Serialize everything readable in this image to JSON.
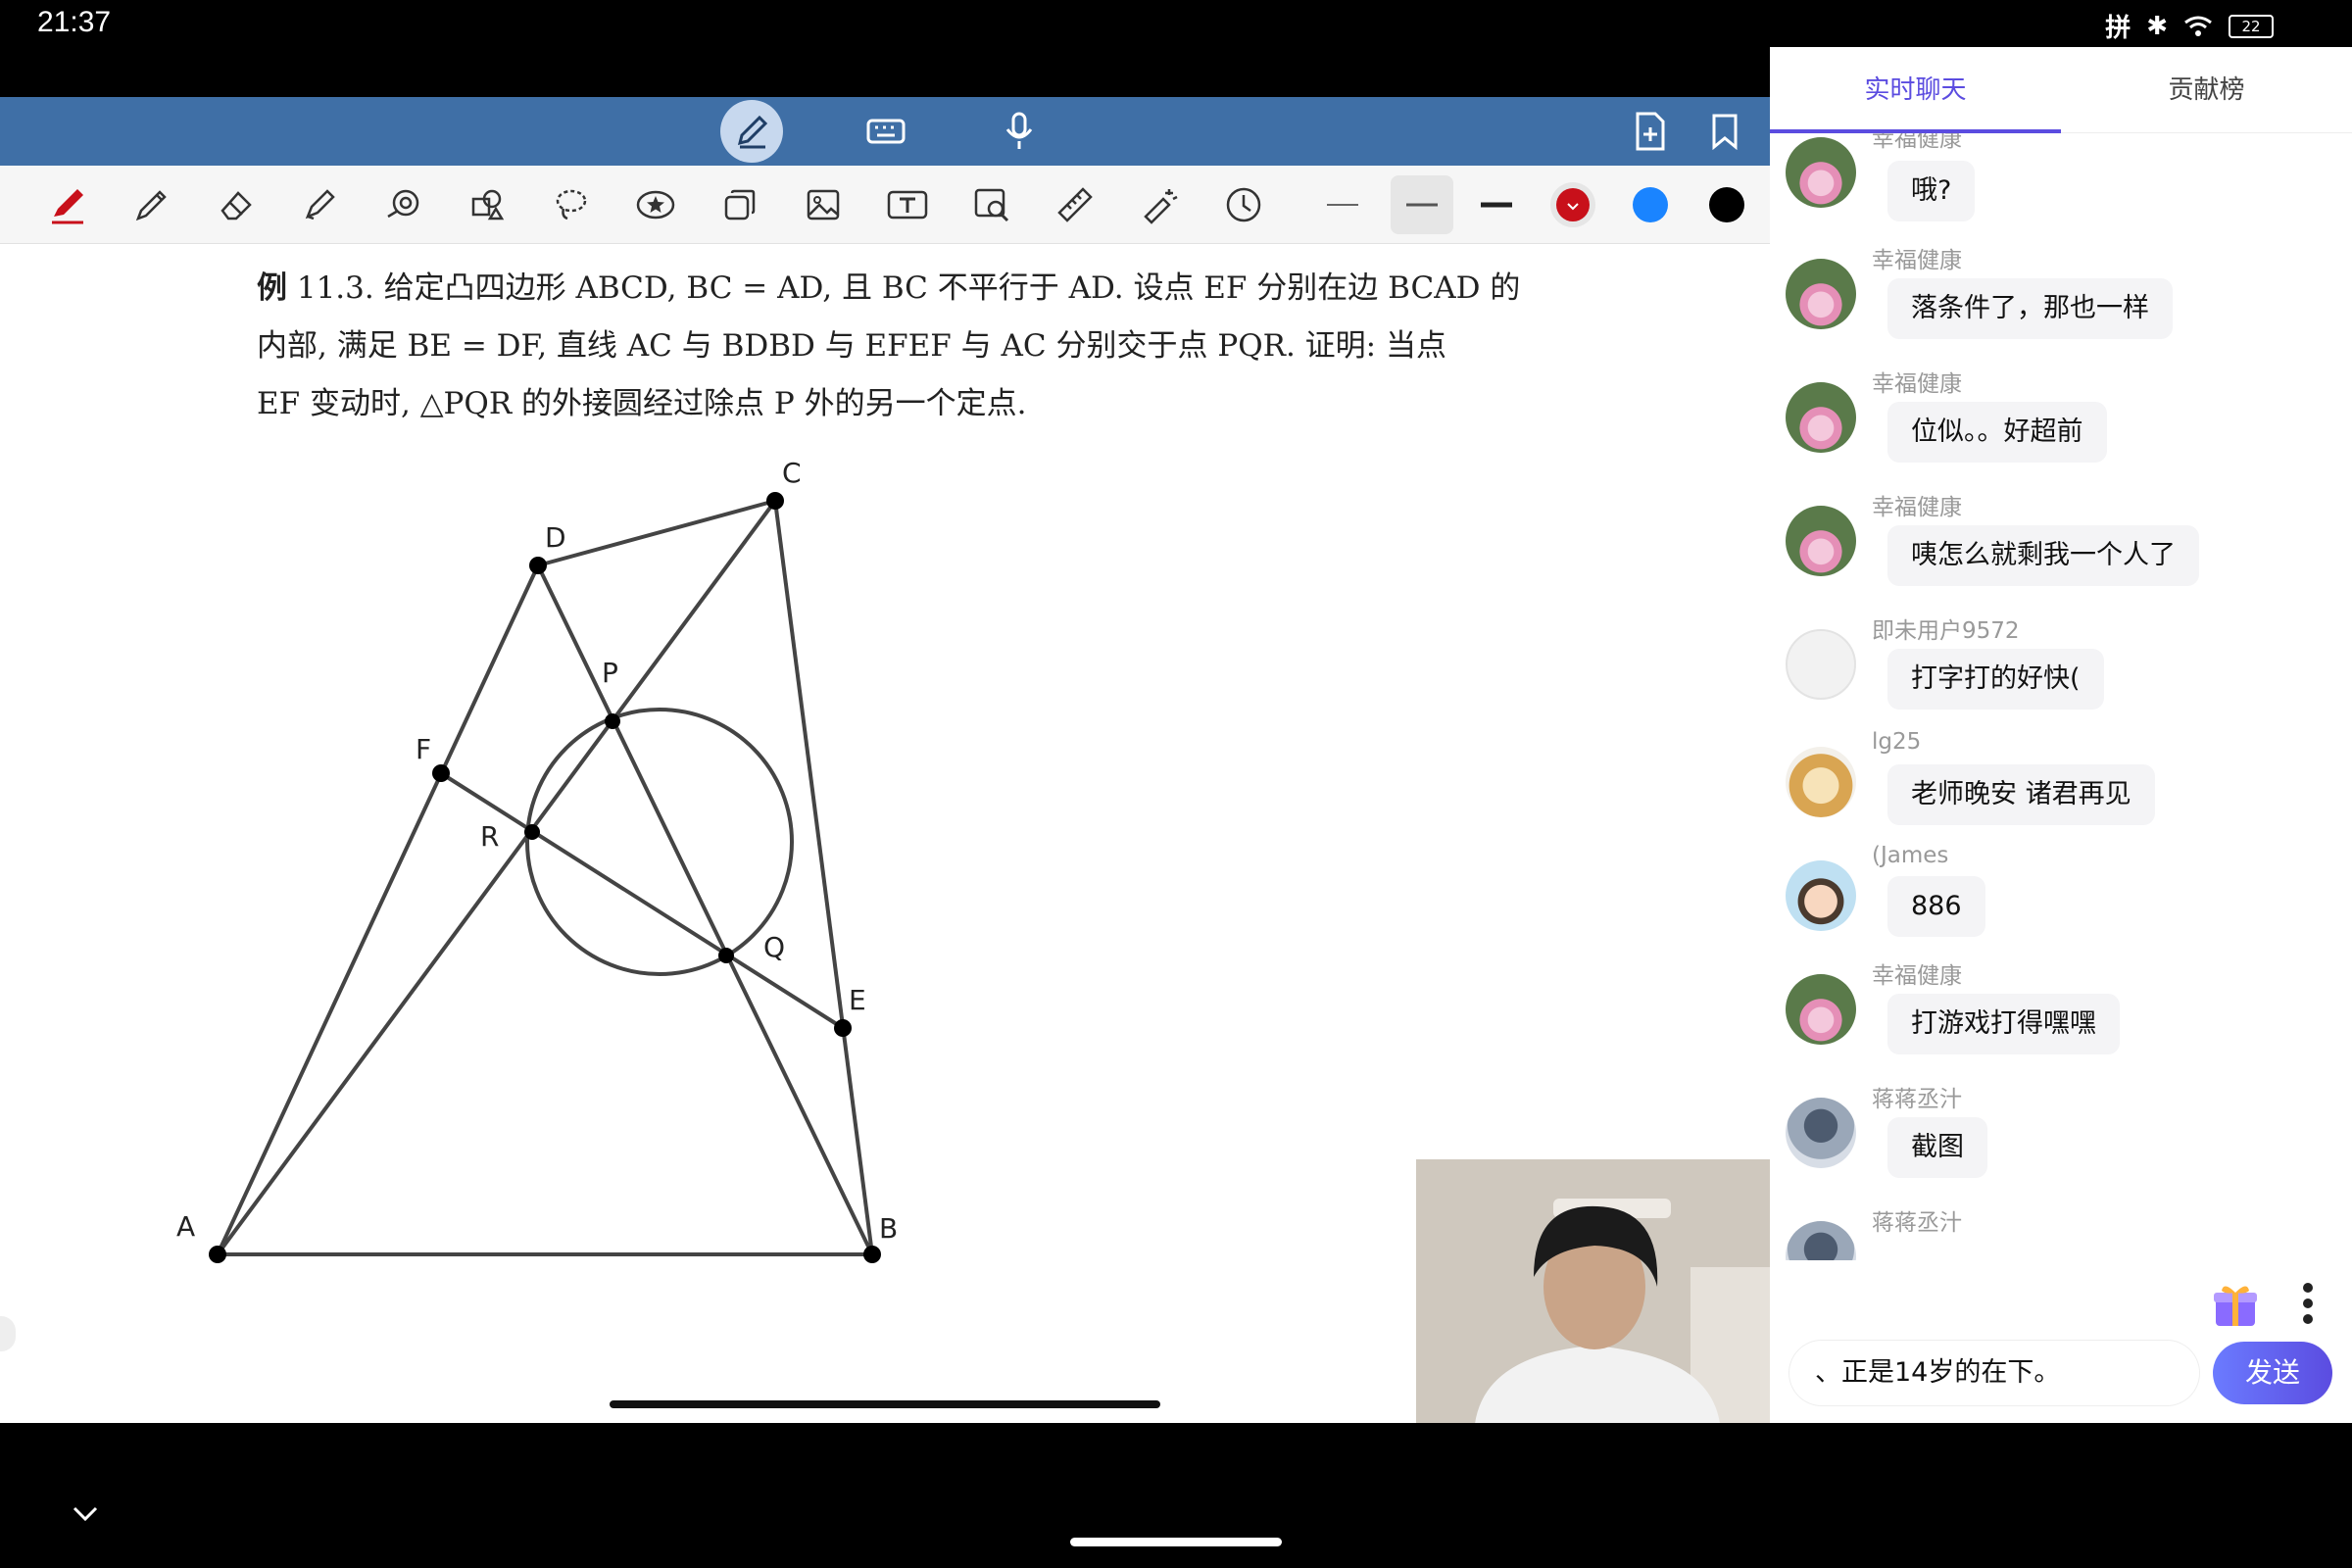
{
  "status": {
    "time": "21:37",
    "ime": "拼",
    "battery": "22"
  },
  "problem": {
    "label": "例",
    "text_line1": "11.3. 给定凸四边形 ABCD, BC = AD, 且 BC 不平行于 AD. 设点 EF 分别在边 BCAD 的",
    "text_line2": "内部, 满足 BE = DF, 直线 AC 与 BDBD 与 EFEF 与 AC 分别交于点 PQR. 证明: 当点",
    "text_line3": "EF 变动时, △PQR 的外接圆经过除点 P 外的另一个定点."
  },
  "figure": {
    "points": {
      "A": "A",
      "B": "B",
      "C": "C",
      "D": "D",
      "E": "E",
      "F": "F",
      "P": "P",
      "Q": "Q",
      "R": "R"
    }
  },
  "panel": {
    "tabs": [
      {
        "label": "实时聊天"
      },
      {
        "label": "贡献榜"
      }
    ],
    "messages": [
      {
        "user": "幸福健康",
        "text": "哦?"
      },
      {
        "user": "幸福健康",
        "text": "落条件了，那也一样"
      },
      {
        "user": "幸福健康",
        "text": "位似。。好超前"
      },
      {
        "user": "幸福健康",
        "text": "咦怎么就剩我一个人了"
      },
      {
        "user": "即未用户9572",
        "text": "打字打的好快("
      },
      {
        "user": "lg25",
        "text": "老师晚安 诸君再见"
      },
      {
        "user": "(James",
        "text": "886"
      },
      {
        "user": "幸福健康",
        "text": "打游戏打得嘿嘿"
      },
      {
        "user": "蒋蒋丞汁",
        "text": "截图"
      },
      {
        "user": "蒋蒋丞汁",
        "text": ""
      }
    ],
    "input_value": "、正是14岁的在下。",
    "send_label": "发送"
  },
  "colors": {
    "accent": "#5b4ce0",
    "toolbar_blue": "#3f6fa6",
    "red_pen": "#c8101a",
    "blue_pen": "#1a84ff",
    "black_pen": "#000000"
  },
  "icons": [
    "pen-mode-icon",
    "keyboard-icon",
    "microphone-icon",
    "add-page-icon",
    "bookmark-icon",
    "red-pen-icon",
    "pencil-icon",
    "eraser-icon",
    "highlighter-icon",
    "shape-icon",
    "stamp-icon",
    "lasso-icon",
    "star-icon",
    "copy-icon",
    "image-icon",
    "text-icon",
    "image-search-icon",
    "ruler-icon",
    "laser-pointer-icon",
    "clock-icon",
    "gift-icon",
    "more-icon",
    "chevron-down-icon"
  ]
}
